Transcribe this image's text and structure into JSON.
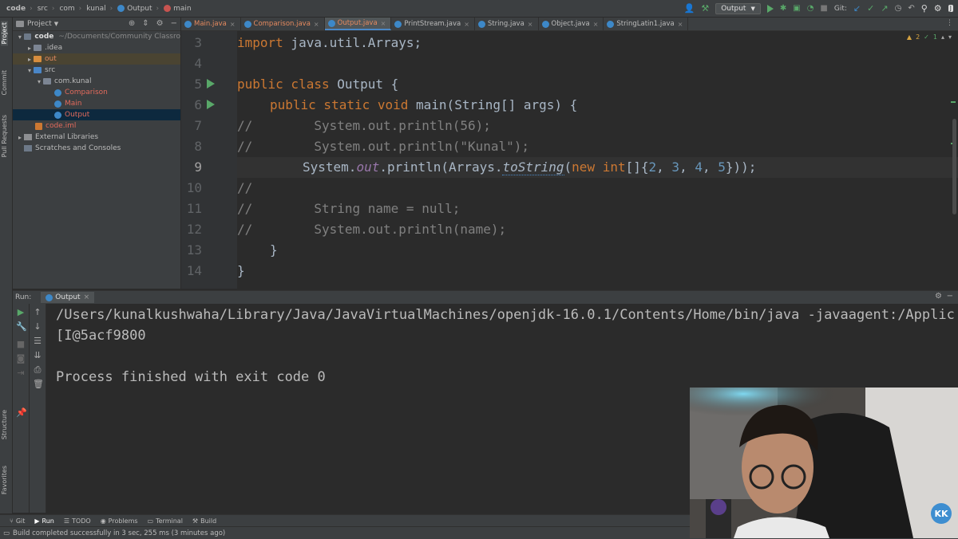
{
  "navbar": {
    "crumbs": [
      "code",
      "src",
      "com",
      "kunal",
      "Output",
      "main"
    ],
    "run_config": "Output",
    "git_label": "Git:"
  },
  "left_strip": {
    "project": "Project",
    "commit": "Commit",
    "pull_requests": "Pull Requests",
    "structure": "Structure",
    "favorites": "Favorites"
  },
  "project": {
    "title": "Project",
    "tree": [
      {
        "label": "code",
        "note": "~/Documents/Community Classro"
      },
      {
        "label": ".idea"
      },
      {
        "label": "out"
      },
      {
        "label": "src"
      },
      {
        "label": "com.kunal"
      },
      {
        "label": "Comparison"
      },
      {
        "label": "Main"
      },
      {
        "label": "Output"
      },
      {
        "label": "code.iml"
      },
      {
        "label": "External Libraries"
      },
      {
        "label": "Scratches and Consoles"
      }
    ]
  },
  "tabs": [
    "Main.java",
    "Comparison.java",
    "Output.java",
    "PrintStream.java",
    "String.java",
    "Object.java",
    "StringLatin1.java"
  ],
  "editor": {
    "line_numbers": [
      "3",
      "4",
      "5",
      "6",
      "7",
      "8",
      "9",
      "10",
      "11",
      "12",
      "13",
      "14"
    ],
    "inspections": {
      "warnings": "2",
      "ok": "1"
    },
    "code": {
      "l3_kw": "import",
      "l3_rest": " java.util.Arrays;",
      "l5_kw": "public class",
      "l5_rest": " Output {",
      "l6_kw": "public static void",
      "l6_rest": " main(String[] args) {",
      "l7": "//        System.out.println(56);",
      "l8_a": "//        System.out.println(",
      "l8_str": "\"Kunal\"",
      "l8_b": ");",
      "l9_a": "System.",
      "l9_out": "out",
      "l9_b": ".println(Arrays.",
      "l9_ts": "toString",
      "l9_c": "(",
      "l9_new": "new int",
      "l9_d": "[]{",
      "l9_n1": "2",
      "l9_n2": "3",
      "l9_n3": "4",
      "l9_n4": "5",
      "l9_e": "}));",
      "l10": "//",
      "l11": "//        String name = null;",
      "l12": "//        System.out.println(name);",
      "l13": "}",
      "l14": "}"
    }
  },
  "run_panel": {
    "run_label": "Run:",
    "tab": "Output",
    "console": [
      "/Users/kunalkushwaha/Library/Java/JavaVirtualMachines/openjdk-16.0.1/Contents/Home/bin/java -javaagent:/Applic",
      "[I@5acf9800",
      "",
      "Process finished with exit code 0"
    ]
  },
  "bottom_tabs": [
    "Git",
    "Run",
    "TODO",
    "Problems",
    "Terminal",
    "Build"
  ],
  "status": "Build completed successfully in 3 sec, 255 ms (3 minutes ago)",
  "webcam": {
    "logo": "KK"
  },
  "colors": {
    "accent": "#4a88c7",
    "run_green": "#59a869",
    "keyword": "#cc7832",
    "number": "#6897bb",
    "string": "#6a8759"
  }
}
